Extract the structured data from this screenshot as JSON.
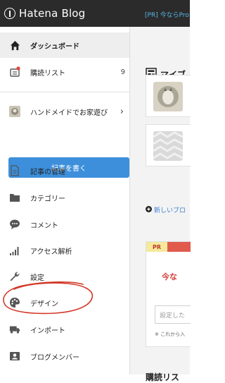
{
  "header": {
    "logo_text": "Hatena Blog",
    "promo_text": "[PR] 今ならPro"
  },
  "sidebar": {
    "items": [
      {
        "label": "ダッシュボード",
        "icon": "home-icon",
        "active": true
      },
      {
        "label": "購読リスト",
        "icon": "subscription-icon",
        "count": "9"
      },
      {
        "label": "ハンドメイドでお家遊び",
        "icon": "blog-avatar",
        "chevron": "›"
      },
      {
        "label": "記事の管理",
        "icon": "document-icon"
      },
      {
        "label": "カテゴリー",
        "icon": "folder-icon"
      },
      {
        "label": "コメント",
        "icon": "comment-icon"
      },
      {
        "label": "アクセス解析",
        "icon": "analytics-icon"
      },
      {
        "label": "設定",
        "icon": "wrench-icon"
      },
      {
        "label": "デザイン",
        "icon": "palette-icon"
      },
      {
        "label": "インポート",
        "icon": "import-icon"
      },
      {
        "label": "ブログメンバー",
        "icon": "member-icon"
      }
    ],
    "write_button": "記事を書く"
  },
  "main": {
    "section_title": "マイブ",
    "new_blog_link": "新しいブロ",
    "pr": {
      "label": "PR",
      "headline": "今な",
      "input_placeholder": "設定した",
      "note": "※ これから入"
    },
    "subscriptions_title": "購読リス"
  },
  "colors": {
    "topbar": "#2b2b2b",
    "accent_blue": "#3d8fdb",
    "notification_dot": "#e0453a",
    "annotation_red": "#d23a2a"
  }
}
